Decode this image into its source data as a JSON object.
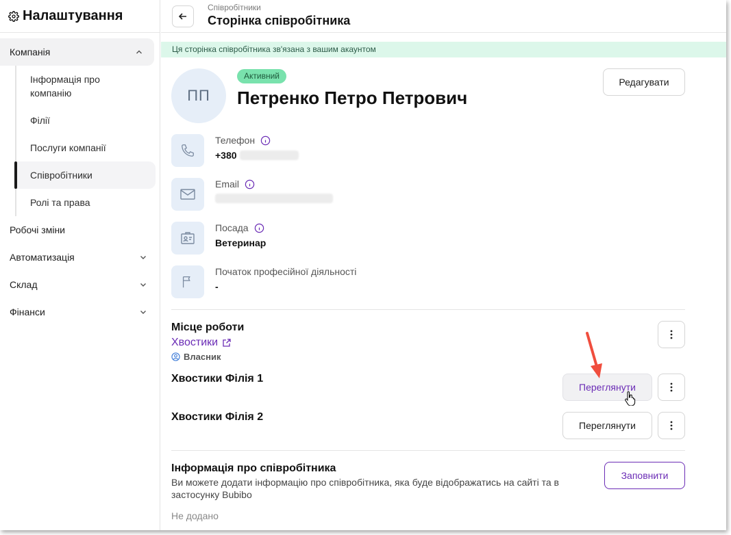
{
  "sidebar": {
    "title": "Налаштування",
    "groups": [
      {
        "label": "Компанія",
        "items": [
          {
            "label": "Інформація про компанію"
          },
          {
            "label": "Філії"
          },
          {
            "label": "Послуги компанії"
          },
          {
            "label": "Співробітники"
          },
          {
            "label": "Ролі та права"
          }
        ]
      }
    ],
    "plain": [
      {
        "label": "Робочі зміни"
      },
      {
        "label": "Автоматизація"
      },
      {
        "label": "Склад"
      },
      {
        "label": "Фінанси"
      }
    ]
  },
  "header": {
    "breadcrumb": "Співробітники",
    "title": "Сторінка співробітника"
  },
  "notice": "Ця сторінка співробітника зв'язана з вашим акаунтом",
  "profile": {
    "initials": "ПП",
    "status": "Активний",
    "name": "Петренко Петро Петрович",
    "edit_label": "Редагувати"
  },
  "fields": {
    "phone": {
      "label": "Телефон",
      "value": "+380"
    },
    "email": {
      "label": "Email",
      "value": ""
    },
    "position": {
      "label": "Посада",
      "value": "Ветеринар"
    },
    "career_start": {
      "label": "Початок професійної діяльності",
      "value": "-"
    }
  },
  "workplace": {
    "title": "Місце роботи",
    "company": "Хвостики",
    "role": "Власник",
    "branches": [
      {
        "name": "Хвостики Філія 1",
        "action": "Переглянути"
      },
      {
        "name": "Хвостики Філія 2",
        "action": "Переглянути"
      }
    ]
  },
  "employee_info": {
    "title": "Інформація про співробітника",
    "description": "Ви можете додати інформацію про співробітника, яка буде відображатись на сайті та в застосунку Bubibo",
    "fill_label": "Заповнити",
    "empty_text": "Не додано"
  },
  "colors": {
    "accent": "#6a2bb5",
    "badge_bg": "#79e2ad",
    "notice_bg": "#dcf7ea",
    "icon_bg": "#e6eef8",
    "annotation_arrow": "#f04e3e"
  }
}
